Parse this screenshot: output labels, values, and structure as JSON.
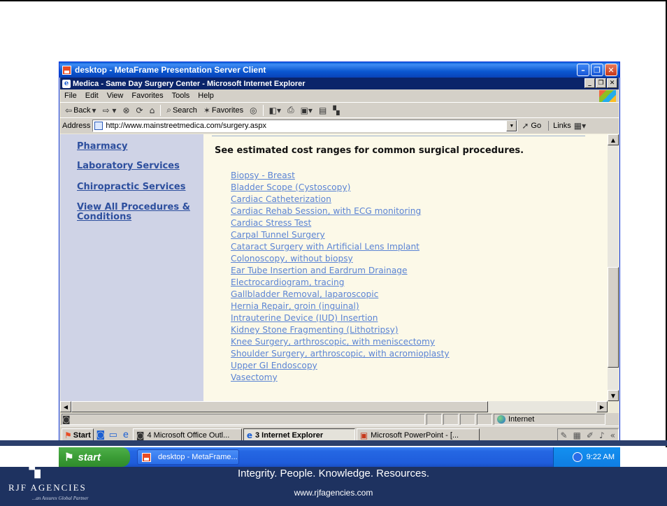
{
  "citrix_window": {
    "title": "desktop - MetaFrame Presentation Server Client"
  },
  "ie_window": {
    "title": "Medica - Same Day Surgery Center - Microsoft Internet Explorer"
  },
  "menu": [
    "File",
    "Edit",
    "View",
    "Favorites",
    "Tools",
    "Help"
  ],
  "toolbar": {
    "back": "Back",
    "search": "Search",
    "favorites": "Favorites"
  },
  "address": {
    "label": "Address",
    "url": "http://www.mainstreetmedica.com/surgery.aspx",
    "go": "Go",
    "links": "Links"
  },
  "sidebar": {
    "links": [
      "Pharmacy",
      "Laboratory Services",
      "Chiropractic Services",
      "View All Procedures & Conditions"
    ]
  },
  "main": {
    "heading": "See estimated cost ranges for common surgical procedures.",
    "procedures": [
      "Biopsy - Breast",
      "Bladder Scope (Cystoscopy)",
      "Cardiac Catheterization",
      "Cardiac Rehab Session, with ECG monitoring",
      "Cardiac Stress Test",
      "Carpal Tunnel Surgery",
      "Cataract Surgery with Artificial Lens Implant",
      "Colonoscopy, without biopsy",
      "Ear Tube Insertion and Eardrum Drainage",
      "Electrocardiogram, tracing",
      "Gallbladder Removal, laparoscopic",
      "Hernia Repair, groin (inguinal)",
      "Intrauterine Device (IUD) Insertion",
      "Kidney Stone Fragmenting (Lithotripsy)",
      "Knee Surgery, arthroscopic, with meniscectomy",
      "Shoulder Surgery, arthroscopic, with acromioplasty",
      "Upper GI Endoscopy",
      "Vasectomy"
    ]
  },
  "status": {
    "zone": "Internet"
  },
  "inner_taskbar": {
    "start": "Start",
    "tasks": [
      "4 Microsoft Office Outl...",
      "3 Internet Explorer",
      "Microsoft PowerPoint - [..."
    ]
  },
  "outer_taskbar": {
    "start": "start",
    "task": "desktop - MetaFrame...",
    "time": "9:22 AM"
  },
  "footer": {
    "tagline": "Integrity. People. Knowledge. Resources.",
    "website": "www.rjfagencies.com",
    "logo_text": "RJF AGENCIES",
    "logo_sub": "...an Assurex Global Partner"
  },
  "colors": {
    "link": "#5b84d4",
    "sidebar_link": "#2d4f9e",
    "sidebar_bg": "#cfd3e6",
    "content_bg": "#fcf9e8",
    "footer_bg": "#1e3260"
  }
}
